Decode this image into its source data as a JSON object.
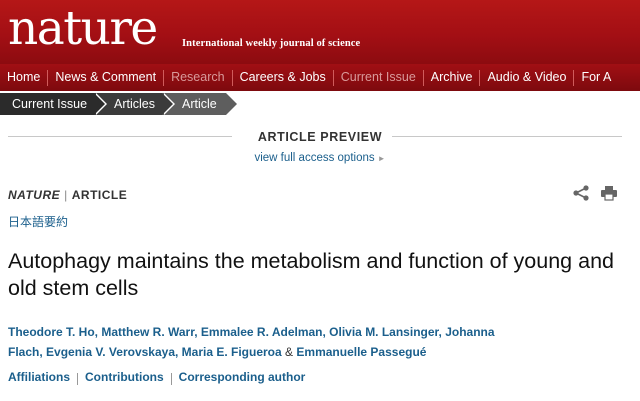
{
  "masthead": {
    "logo": "nature",
    "tagline": "International weekly journal of science"
  },
  "nav": {
    "items": [
      {
        "label": "Home"
      },
      {
        "label": "News & Comment"
      },
      {
        "label": "Research"
      },
      {
        "label": "Careers & Jobs"
      },
      {
        "label": "Current Issue"
      },
      {
        "label": "Archive"
      },
      {
        "label": "Audio & Video"
      },
      {
        "label": "For A"
      }
    ]
  },
  "breadcrumb": {
    "items": [
      "Current Issue",
      "Articles",
      "Article"
    ]
  },
  "preview": {
    "heading": "ARTICLE PREVIEW",
    "link": "view full access options"
  },
  "article": {
    "journal": "NATURE",
    "separator": "|",
    "type": "ARTICLE",
    "japanese_summary": "日本語要約",
    "title": "Autophagy maintains the metabolism and function of young and old stem cells",
    "authors_line1": "Theodore T. Ho, Matthew R. Warr, Emmalee R. Adelman, Olivia M. Lansinger, Johanna",
    "authors_line2": "Flach, Evgenia V. Verovskaya, Maria E. Figueroa",
    "authors_amp": "&",
    "authors_last": "Emmanuelle Passegué",
    "links": [
      "Affiliations",
      "Contributions",
      "Corresponding author"
    ]
  },
  "colors": {
    "brand_red": "#a30f14",
    "link_blue": "#1b5f8c"
  }
}
